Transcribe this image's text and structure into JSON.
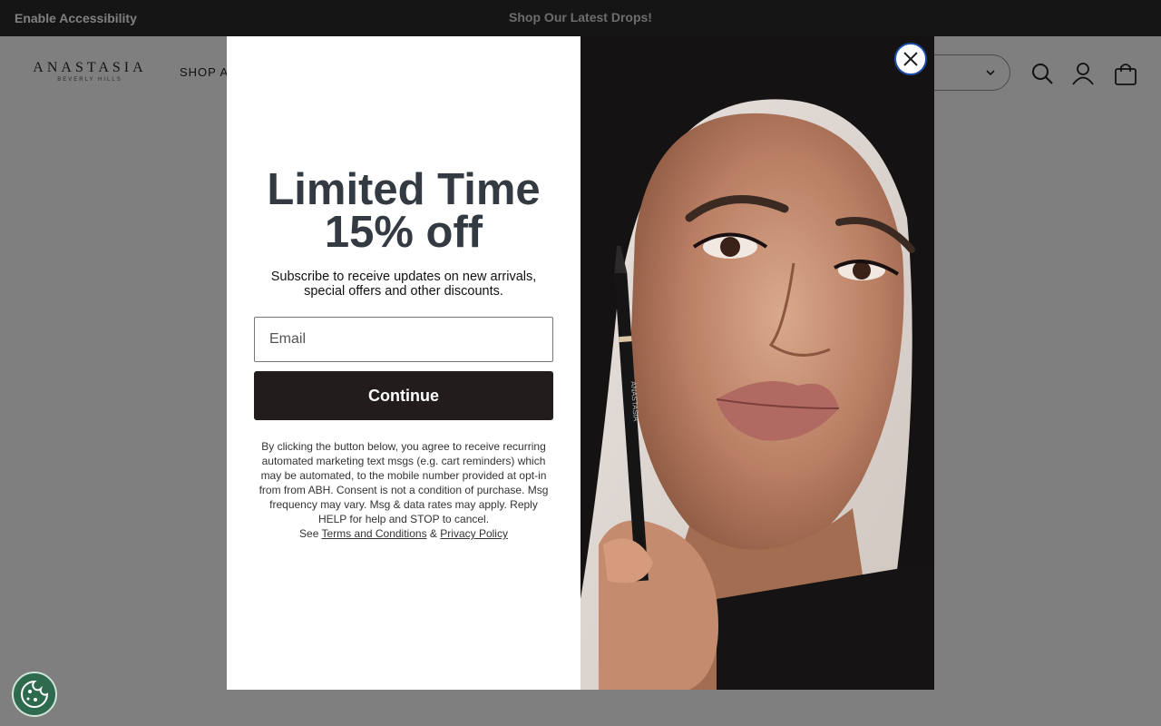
{
  "topbar": {
    "accessibility_label": "Enable Accessibility",
    "promo_text": "Shop Our Latest Drops!"
  },
  "header": {
    "logo_text": "ANASTASIA",
    "logo_sub": "BEVERLY HILLS",
    "shop_all": "SHOP AL",
    "icons": [
      "search-icon",
      "account-icon",
      "bag-icon"
    ]
  },
  "modal": {
    "headline_line1": "Limited Time",
    "headline_line2": "15% off",
    "subtext": "Subscribe to receive updates on new arrivals, special offers and other discounts.",
    "email_placeholder": "Email",
    "continue_label": "Continue",
    "legal_text": "By clicking the button below, you agree to receive recurring automated marketing text msgs (e.g. cart reminders) which may be automated, to the mobile number provided at opt-in from from ABH. Consent is not a condition of purchase. Msg frequency may vary. Msg & data rates may apply. Reply HELP for help and STOP to cancel.",
    "legal_see": "See",
    "terms_link": "Terms and Conditions",
    "legal_amp": "&",
    "privacy_link": "Privacy Policy",
    "pencil_text": "ANASTASIA"
  },
  "colors": {
    "topbar_bg": "#2b2b2b",
    "button_bg": "#221d1c",
    "headline": "#333a42",
    "cookie_bg": "#2e6b4e"
  }
}
